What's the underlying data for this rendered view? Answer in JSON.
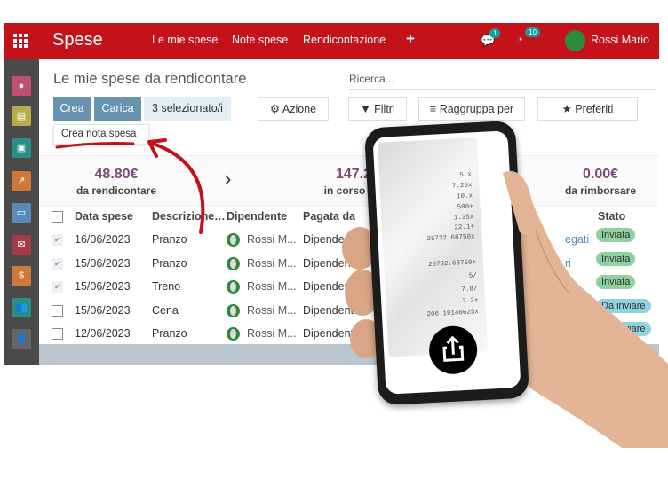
{
  "header": {
    "app": "Spese",
    "nav": [
      "Le mie spese",
      "Note spese",
      "Rendicontazione"
    ],
    "plus": "+",
    "messages_count": "1",
    "activities_count": "10",
    "user": "Rossi Mario",
    "color": "#c4121a"
  },
  "sidebar": {
    "icons": [
      "discuss-icon",
      "calendar-icon",
      "contacts-icon",
      "dashboard-icon",
      "card-icon",
      "gift-icon",
      "invoice-icon",
      "team-icon",
      "employee-expense-icon"
    ]
  },
  "page": {
    "title": "Le mie spese da rendicontare",
    "search_placeholder": "Ricerca...",
    "buttons": {
      "create": "Crea",
      "upload": "Carica",
      "selected": "3 selezionato/i",
      "action": "Azione",
      "filters": "Filtri",
      "group_by": "Raggruppa per",
      "favorites": "Preferiti"
    },
    "dropdown_item": "Crea nota spesa"
  },
  "summary": [
    {
      "value": "48.80€",
      "label": "da rendicontare"
    },
    {
      "value": "147.2…",
      "label": "in corso di v…"
    },
    {
      "value": "0.00€",
      "label": "da rimborsare"
    }
  ],
  "table": {
    "headers": [
      "Data spese",
      "Descrizione…",
      "Dipendente",
      "Pagata da",
      "Stato"
    ],
    "rows": [
      {
        "checked": true,
        "date": "16/06/2023",
        "desc": "Pranzo",
        "employee": "Rossi M...",
        "paid_by": "Dipendente",
        "extra": "egati",
        "status": "Inviata"
      },
      {
        "checked": true,
        "date": "15/06/2023",
        "desc": "Pranzo",
        "employee": "Rossi M...",
        "paid_by": "Dipendente",
        "extra": "ri",
        "status": "Inviata"
      },
      {
        "checked": true,
        "date": "15/06/2023",
        "desc": "Treno",
        "employee": "Rossi M...",
        "paid_by": "Dipendente",
        "extra": "",
        "status": "Inviata"
      },
      {
        "checked": false,
        "date": "15/06/2023",
        "desc": "Cena",
        "employee": "Rossi M...",
        "paid_by": "Dipendente",
        "extra": "",
        "status": "Da inviare"
      },
      {
        "checked": false,
        "date": "12/06/2023",
        "desc": "Pranzo",
        "employee": "Rossi M...",
        "paid_by": "Dipendente",
        "extra": "",
        "status": "Da inviare"
      }
    ]
  },
  "status_colors": {
    "Inviata": "#8fd19e",
    "Da inviare": "#8fd3e0"
  },
  "receipt": {
    "lines": [
      "5.x",
      "7.25x",
      "10.x",
      "500+",
      "1.35x",
      "22.1+",
      "25732.68750x",
      "25732.68750+",
      "5/",
      "7.8/",
      "3.2+",
      "206.19140625x"
    ]
  }
}
